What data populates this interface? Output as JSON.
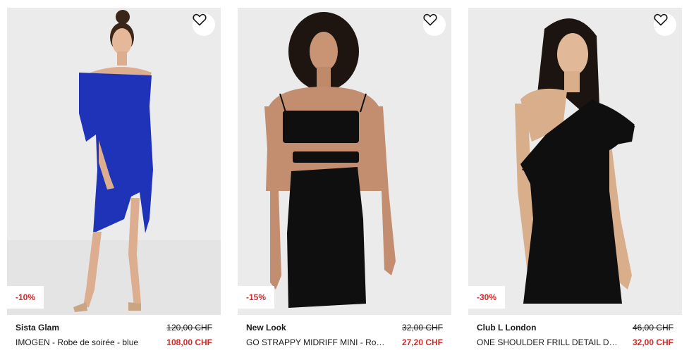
{
  "colors": {
    "discount": "#d12a2a",
    "text": "#1a1a1a",
    "photo_bg": "#ebebeb"
  },
  "products": [
    {
      "brand": "Sista Glam",
      "name": "IMOGEN - Robe de soirée - blue",
      "old_price": "120,00 CHF",
      "new_price": "108,00 CHF",
      "discount": "-10%",
      "dress_color": "#1f33b8",
      "wishlist_icon": "heart-icon"
    },
    {
      "brand": "New Look",
      "name": "GO STRAPPY MIDRIFF MINI - Robe de soirée - black",
      "old_price": "32,00 CHF",
      "new_price": "27,20 CHF",
      "discount": "-15%",
      "dress_color": "#0f0f0f",
      "wishlist_icon": "heart-icon"
    },
    {
      "brand": "Club L London",
      "name": "ONE SHOULDER FRILL DETAIL DRESS - Robe de soirée - black",
      "old_price": "46,00 CHF",
      "new_price": "32,00 CHF",
      "discount": "-30%",
      "dress_color": "#0f0f0f",
      "wishlist_icon": "heart-icon"
    }
  ]
}
